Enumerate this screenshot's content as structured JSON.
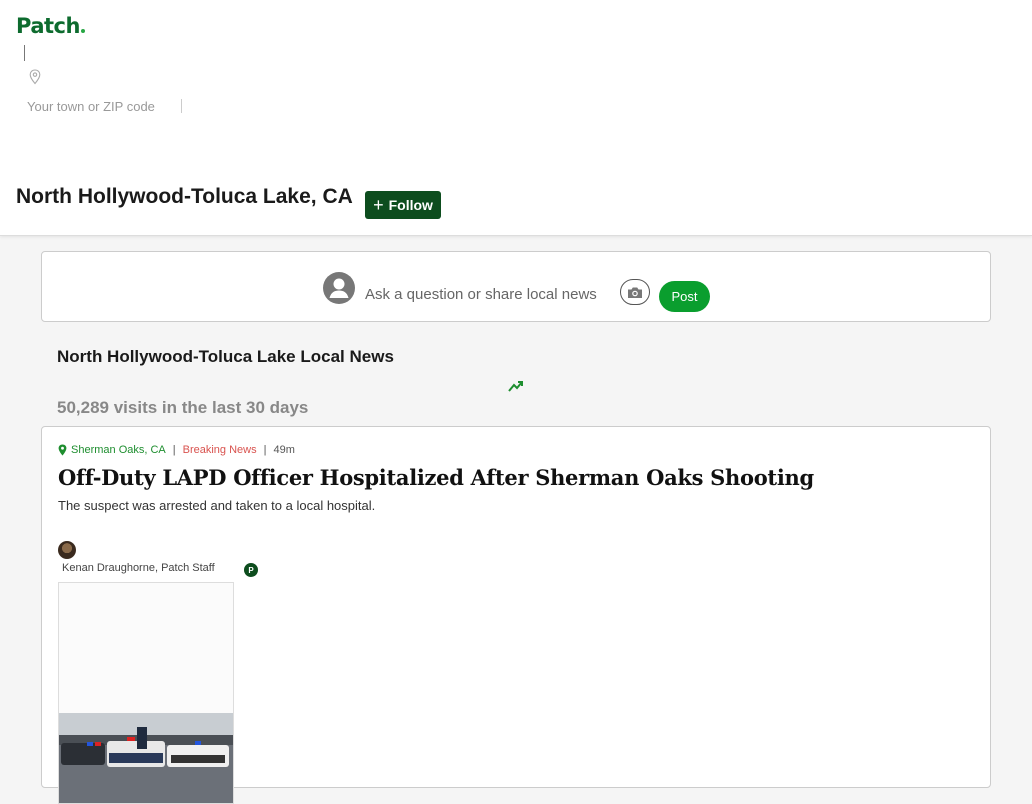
{
  "header": {
    "logo_text": "Patch",
    "town_input_placeholder": "Your town or ZIP code",
    "town_title": "North Hollywood-Toluca Lake, CA",
    "follow_label": "Follow",
    "brand_color": "#0d6b2e"
  },
  "composer": {
    "prompt": "Ask a question or share local news",
    "post_label": "Post",
    "post_color": "#0a9e2e"
  },
  "section": {
    "title": "North Hollywood-Toluca Lake Local News",
    "visits": "50,289 visits in the last 30 days"
  },
  "article": {
    "location": "Sherman Oaks, CA",
    "category": "Breaking News",
    "time": "49m",
    "headline": "Off-Duty LAPD Officer Hospitalized After Sherman Oaks Shooting",
    "summary": "The suspect was arrested and taken to a local hospital.",
    "author": "Kenan Draughorne, Patch Staff",
    "badge": "P"
  },
  "icons": {
    "location": "map-pin-icon",
    "camera": "camera-icon",
    "trending": "trending-up-icon",
    "user": "user-avatar-icon"
  }
}
